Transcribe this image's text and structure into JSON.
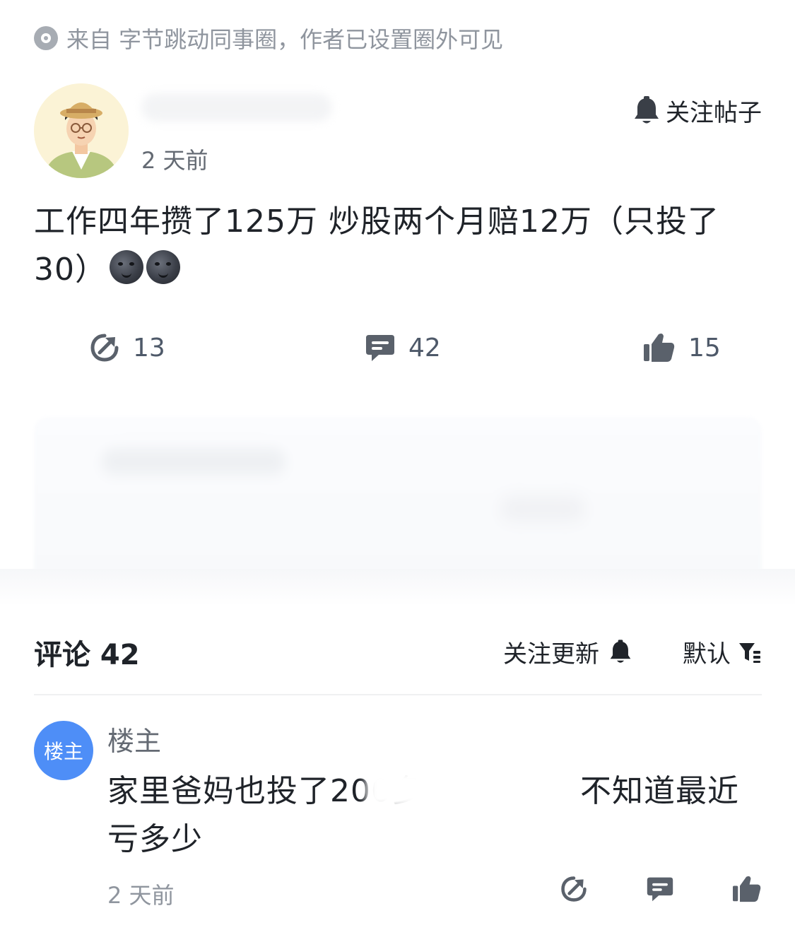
{
  "source": {
    "icon": "circle-dot-icon",
    "text": "来自 字节跳动同事圈，作者已设置圈外可见"
  },
  "post": {
    "author": {
      "avatar_icon": "avatar-illustration",
      "time": "2 天前"
    },
    "follow_post": {
      "icon": "bell-icon",
      "label": "关注帖子"
    },
    "content_line1": "工作四年攒了125万 炒股两个月赔12万（只投了",
    "content_line2": "30）",
    "emoji": [
      "new-moon-face",
      "new-moon-face"
    ],
    "actions": {
      "share": {
        "icon": "share-icon",
        "count": "13"
      },
      "comment": {
        "icon": "comment-icon",
        "count": "42"
      },
      "like": {
        "icon": "thumbs-up-icon",
        "count": "15"
      }
    }
  },
  "comments_section": {
    "title": "评论 42",
    "follow_updates": {
      "label": "关注更新",
      "icon": "bell-icon"
    },
    "sort": {
      "label": "默认",
      "icon": "filter-icon"
    },
    "items": [
      {
        "avatar_text": "楼主",
        "user": "楼主",
        "body_line1": "家里爸妈也投了200多",
        "body_line1_tail": "不知道最近",
        "body_line2": "亏多少",
        "time": "2 天前",
        "actions": [
          "share-icon",
          "comment-icon",
          "thumbs-up-icon"
        ]
      }
    ]
  },
  "colors": {
    "accent_blue": "#4e8ef7",
    "text_primary": "#1f2329",
    "text_secondary": "#646a73",
    "text_muted": "#8f959e",
    "icon_gray": "#5a616b"
  }
}
